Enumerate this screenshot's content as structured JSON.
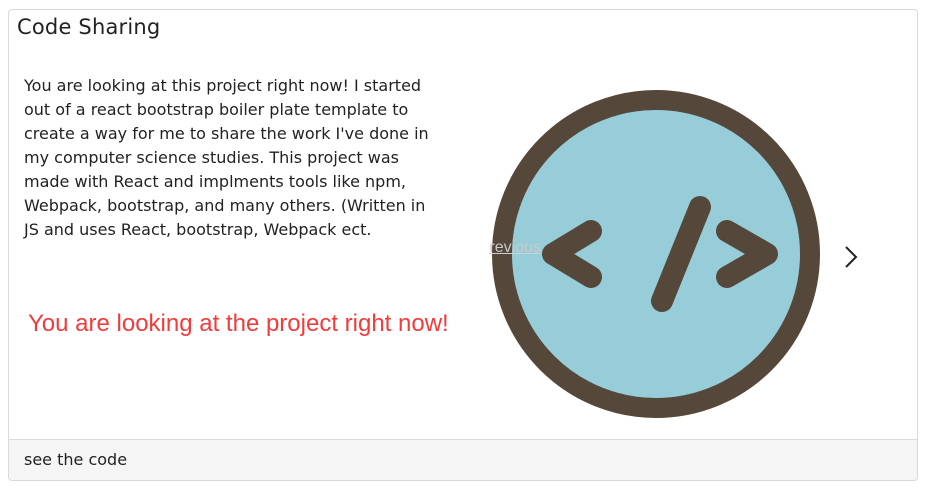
{
  "card": {
    "title": "Code Sharing",
    "description": "You are looking at this project right now! I started out of a react bootstrap boiler plate template to create a way for me to share the work I've done in my computer science studies. This project was made with React and implments tools like npm, Webpack, bootstrap, and many others. (Written in JS and uses React, bootstrap, Webpack ect.",
    "highlight": "You are looking at the project right now!",
    "footer_link": "see the code"
  },
  "carousel": {
    "prev_label": "Previous",
    "next_icon": "chevron-right-icon",
    "image_icon": "code-icon"
  },
  "colors": {
    "highlight": "#f23b3b",
    "icon_fill": "#96cdd9",
    "icon_stroke": "#55473a",
    "footer_bg": "#f5f5f5"
  }
}
